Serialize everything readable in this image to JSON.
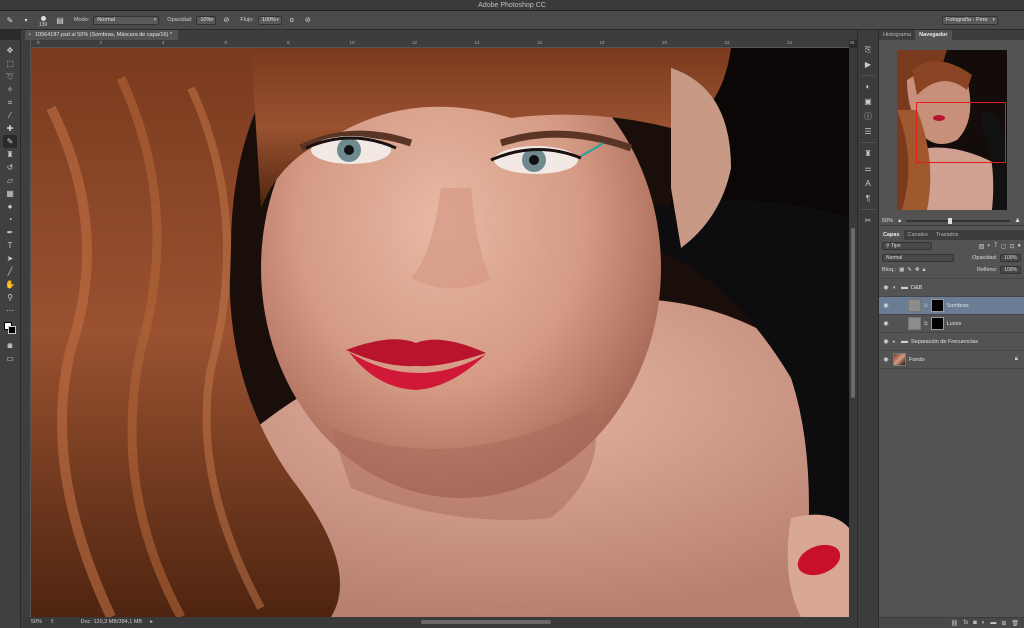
{
  "app": {
    "title": "Adobe Photoshop CC"
  },
  "options_bar": {
    "brush_size": "139",
    "mode_label": "Modo:",
    "mode_value": "Normal",
    "opacity_label": "Opacidad:",
    "opacity_value": "10%",
    "flow_label": "Flujo:",
    "flow_value": "100%",
    "workspace": "Fotografía - Pere"
  },
  "document": {
    "tab_title": "10564187.psd al 50% (Sombras, Máscara de capa/16) *",
    "ruler_ticks": [
      "0",
      "2",
      "4",
      "6",
      "8",
      "10",
      "12",
      "14",
      "16",
      "18",
      "20",
      "22",
      "24",
      "26"
    ]
  },
  "status": {
    "zoom": "50%",
    "doc_info": "Doc: 120,3 MB/384,1 MB"
  },
  "navigator": {
    "tabs": [
      "Histograma",
      "Navegador"
    ],
    "active_tab": "Navegador",
    "zoom": "50%"
  },
  "layers_panel": {
    "tabs": [
      "Capas",
      "Canales",
      "Trazados"
    ],
    "active_tab": "Capas",
    "filter_kind": "Tipo",
    "blend_mode": "Normal",
    "opacity_label": "Opacidad:",
    "opacity_value": "100%",
    "lock_label": "Bloq.:",
    "fill_label": "Relleno:",
    "fill_value": "100%",
    "layers": [
      {
        "name": "D&B",
        "type": "group",
        "selected": false
      },
      {
        "name": "Sombras",
        "type": "masked",
        "selected": true
      },
      {
        "name": "Luces",
        "type": "masked",
        "selected": false
      },
      {
        "name": "Separación de Frecuencias",
        "type": "group",
        "selected": false
      },
      {
        "name": "Fondo",
        "type": "background",
        "selected": false
      }
    ]
  },
  "colors": {
    "selected_layer": "#6a7d95",
    "navigator_rect": "#e02020",
    "foreground": "#ffffff",
    "background": "#000000"
  }
}
